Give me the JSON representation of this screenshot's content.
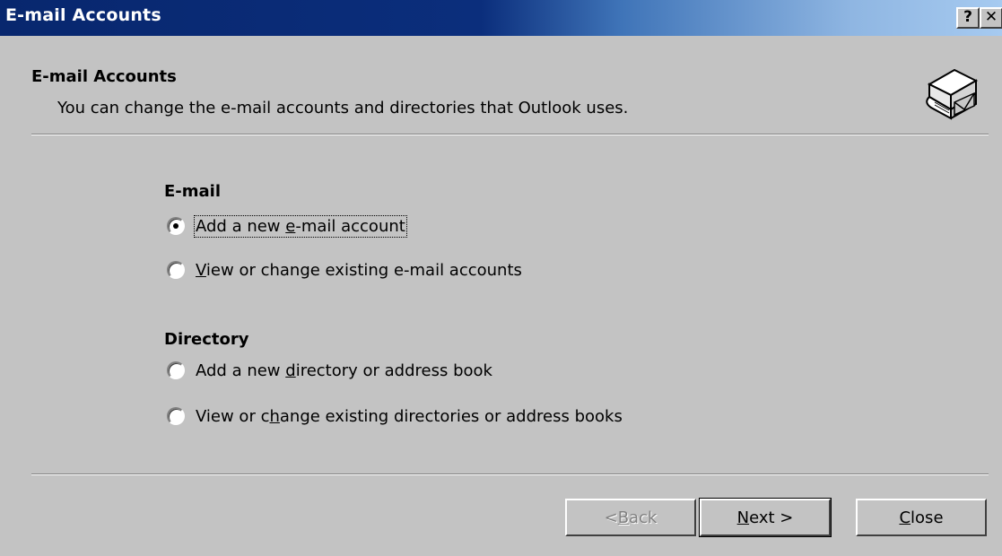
{
  "window": {
    "title": "E-mail Accounts",
    "help_button": "?",
    "close_button": "✕"
  },
  "header": {
    "title": "E-mail Accounts",
    "description": "You can change the e-mail accounts and directories that Outlook uses.",
    "icon": "email-accounts-icon"
  },
  "email_section": {
    "label": "E-mail",
    "options": [
      {
        "pre": "Add a new ",
        "key": "e",
        "post": "-mail account",
        "selected": true
      },
      {
        "pre": "",
        "key": "V",
        "post": "iew or change existing e-mail accounts",
        "selected": false
      }
    ]
  },
  "directory_section": {
    "label": "Directory",
    "options": [
      {
        "pre": "Add a new ",
        "key": "d",
        "post": "irectory or address book",
        "selected": false
      },
      {
        "pre": "View or c",
        "key": "h",
        "post": "ange existing directories or address books",
        "selected": false
      }
    ]
  },
  "buttons": {
    "back": {
      "pre": "< ",
      "key": "B",
      "post": "ack",
      "enabled": false
    },
    "next": {
      "pre": "",
      "key": "N",
      "post": "ext >",
      "enabled": true
    },
    "close": {
      "pre": "",
      "key": "C",
      "post": "lose",
      "enabled": true
    }
  },
  "colors": {
    "titlebar_start": "#08276e",
    "titlebar_end": "#a6caf0",
    "dialog_bg": "#c3c3c3"
  }
}
